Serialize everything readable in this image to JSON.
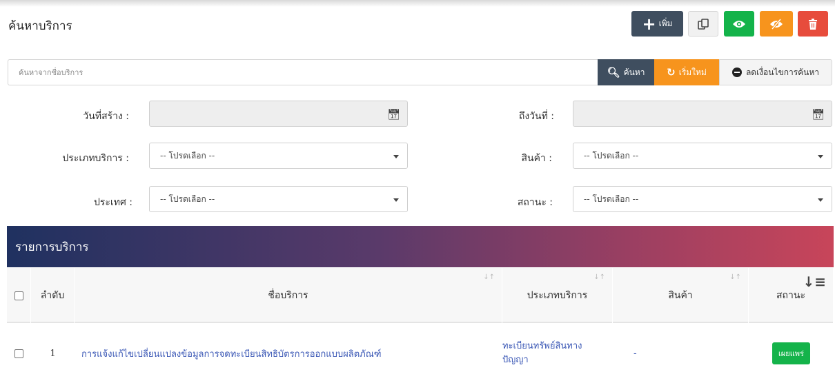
{
  "page": {
    "title": "ค้นหาบริการ"
  },
  "toolbar": {
    "add_label": "เพิ่ม",
    "copy_icon": "copy-icon",
    "show_icon": "eye-icon",
    "hide_icon": "eye-slash-icon",
    "delete_icon": "trash-icon"
  },
  "search": {
    "placeholder": "ค้นหาจากชื่อบริการ",
    "search_label": "ค้นหา",
    "reset_label": "เริ่มใหม่",
    "reduce_label": "ลดเงื่อนไขการค้นหา"
  },
  "filters": {
    "created_date_label": "วันที่สร้าง :",
    "to_date_label": "ถึงวันที่ :",
    "service_type_label": "ประเภทบริการ :",
    "service_type_value": "-- โปรดเลือก --",
    "product_label": "สินค้า :",
    "product_value": "-- โปรดเลือก --",
    "country_label": "ประเทศ :",
    "country_value": "-- โปรดเลือก --",
    "status_label": "สถานะ :",
    "status_value": "-- โปรดเลือก --"
  },
  "list": {
    "title": "รายการบริการ",
    "columns": {
      "no": "ลำดับ",
      "name": "ชื่อบริการ",
      "type": "ประเภทบริการ",
      "product": "สินค้า",
      "status": "สถานะ"
    },
    "rows": [
      {
        "no": "1",
        "name": "การแจ้งแก้ไขเปลี่ยนแปลงข้อมูลการจดทะเบียนสิทธิบัตรการออกแบบผลิตภัณฑ์",
        "type": "ทะเบียนทรัพย์สินทาง ปัญญา",
        "product": "-",
        "status": "เผยแพร่"
      }
    ]
  },
  "colors": {
    "dark": "#3f4e5f",
    "orange": "#f7941d",
    "green": "#14b34a",
    "red": "#e74c3c",
    "link": "#3a57b5"
  }
}
